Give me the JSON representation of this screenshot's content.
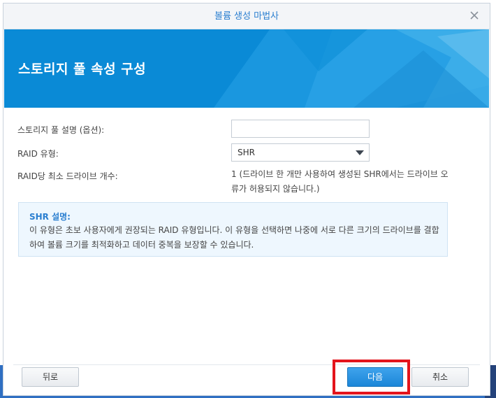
{
  "window": {
    "title": "볼륨 생성 마법사"
  },
  "banner": {
    "title": "스토리지 풀 속성 구성"
  },
  "form": {
    "description_label": "스토리지 풀 설명 (옵션):",
    "description_value": "",
    "raid_type_label": "RAID 유형:",
    "raid_type_value": "SHR",
    "min_drives_label": "RAID당 최소 드라이브 개수:",
    "min_drives_value": "1 (드라이브 한 개만 사용하여 생성된 SHR에서는 드라이브 오류가 허용되지 않습니다.)"
  },
  "info": {
    "title": "SHR 설명:",
    "body": "이 유형은 초보 사용자에게 권장되는 RAID 유형입니다. 이 유형을 선택하면 나중에 서로 다른 크기의 드라이브를 결합하여 볼륨 크기를 최적화하고 데이터 중복을 보장할 수 있습니다."
  },
  "buttons": {
    "back": "뒤로",
    "next": "다음",
    "cancel": "취소"
  },
  "icons": {
    "close": "close-icon",
    "dropdown": "chevron-down-icon"
  },
  "colors": {
    "accent": "#0a8ad6",
    "highlight": "#e3141c"
  }
}
